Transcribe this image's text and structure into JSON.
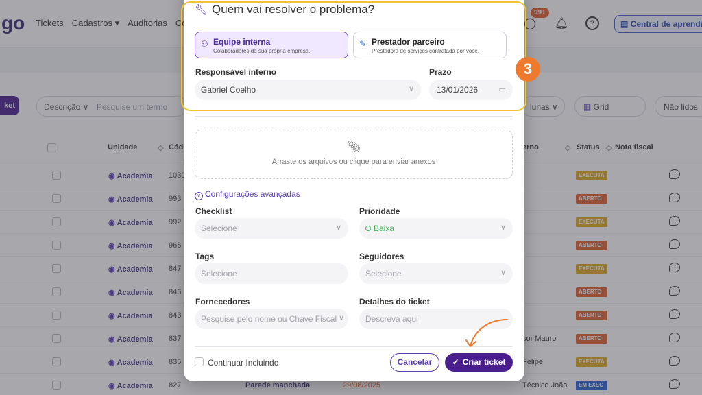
{
  "app": {
    "logo": "go",
    "nav": [
      "Tickets",
      "Cadastros ▾",
      "Auditorias",
      "Co"
    ],
    "notif_badge": "99+",
    "help": "?",
    "learn_center": "Central de aprendi"
  },
  "toolbar": {
    "new_ticket": "ket",
    "filter_field": "Descrição ∨",
    "search_placeholder": "Pesquise um termo",
    "columns": "lunas ∨",
    "grid": "Grid",
    "unread": "Não lidos"
  },
  "table": {
    "headers": {
      "unit": "Unidade",
      "code": "Códig",
      "resp": "erno",
      "status": "Status",
      "invoice": "Nota fiscal"
    },
    "rows": [
      {
        "unit": "Academia",
        "code": "1030",
        "resp": "",
        "status": "EXECUTA",
        "color": "#e0a81c"
      },
      {
        "unit": "Academia",
        "code": "993",
        "resp": "",
        "status": "ABERTO",
        "color": "#e2622a"
      },
      {
        "unit": "Academia",
        "code": "992",
        "resp": "",
        "status": "EXECUTA",
        "color": "#e0a81c"
      },
      {
        "unit": "Academia",
        "code": "966",
        "resp": "",
        "status": "ABERTO",
        "color": "#e2622a"
      },
      {
        "unit": "Academia",
        "code": "847",
        "resp": "",
        "status": "EXECUTA",
        "color": "#e0a81c"
      },
      {
        "unit": "Academia",
        "code": "846",
        "resp": "",
        "status": "ABERTO",
        "color": "#e2622a"
      },
      {
        "unit": "Academia",
        "code": "843",
        "resp": "",
        "status": "ABERTO",
        "color": "#e2622a"
      },
      {
        "unit": "Academia",
        "code": "837",
        "resp": "sor Mauro",
        "status": "ABERTO",
        "color": "#e2622a"
      },
      {
        "unit": "Academia",
        "code": "835",
        "resp": "Felipe",
        "status": "EXECUTA",
        "color": "#e0a81c"
      },
      {
        "unit": "Academia",
        "code": "827",
        "resp": "Técnico João",
        "status": "EM EXEC",
        "color": "#2b5fd6",
        "title": "Parede manchada",
        "date": "29/08/2025"
      }
    ]
  },
  "modal": {
    "title": "Quem vai resolver o problema?",
    "step": "3",
    "internal": {
      "title": "Equipe interna",
      "subtitle": "Colaboradores da sua própria empresa."
    },
    "partner": {
      "title": "Prestador parceiro",
      "subtitle": "Prestadora de serviços contratada por você."
    },
    "responsible_label": "Responsável interno",
    "responsible_value": "Gabriel Coelho",
    "deadline_label": "Prazo",
    "deadline_value": "13/01/2026",
    "dropzone_text": "Arraste os arquivos ou clique para enviar anexos",
    "advanced": "Configurações avançadas",
    "checklist_label": "Checklist",
    "checklist_placeholder": "Selecione",
    "priority_label": "Prioridade",
    "priority_value": "Baixa",
    "tags_label": "Tags",
    "tags_placeholder": "Selecione",
    "followers_label": "Seguidores",
    "followers_placeholder": "Selecione",
    "suppliers_label": "Fornecedores",
    "suppliers_placeholder": "Pesquise pelo nome ou Chave Fiscal",
    "details_label": "Detalhes do ticket",
    "details_placeholder": "Descreva aqui",
    "continue_label": "Continuar Incluindo",
    "cancel": "Cancelar",
    "create": "Criar ticket"
  },
  "colors": {
    "brand": "#4a1e8c",
    "accent": "#5b3db5",
    "highlight": "#f4c430",
    "step": "#ee7a2d"
  }
}
